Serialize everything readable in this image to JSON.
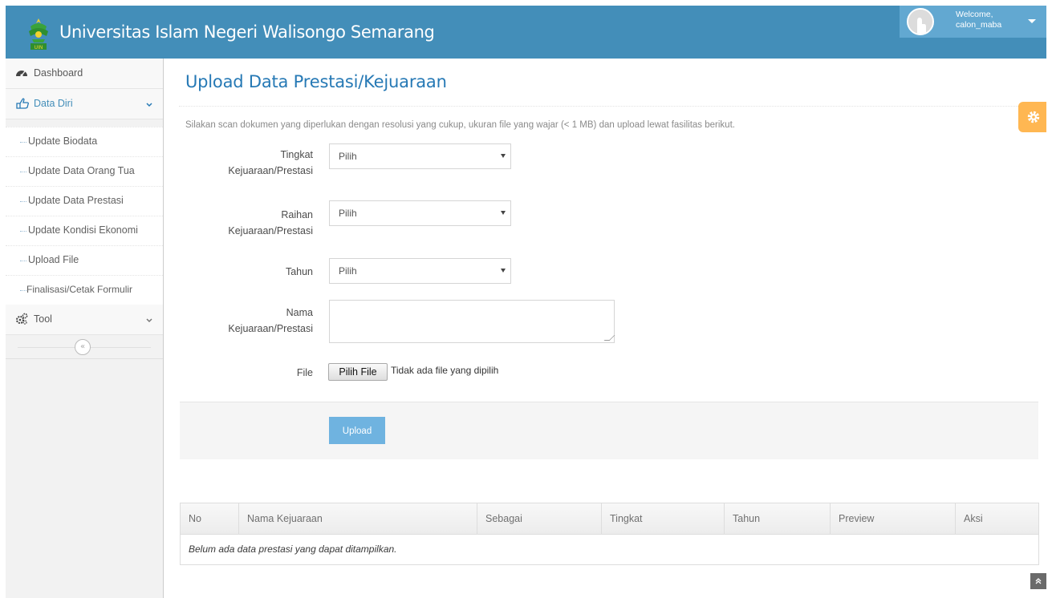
{
  "navbar": {
    "brand": "Universitas Islam Negeri Walisongo Semarang",
    "user_welcome": "Welcome,",
    "user_name": "calon_maba"
  },
  "sidebar": {
    "items": [
      {
        "label": "Dashboard",
        "icon": "tachometer-icon"
      },
      {
        "label": "Data Diri",
        "icon": "hand-pointing-icon",
        "open": true
      },
      {
        "label": "Tool",
        "icon": "gears-icon"
      }
    ],
    "submenu": [
      "Update Biodata",
      "Update Data Orang Tua",
      "Update Data Prestasi",
      "Update Kondisi Ekonomi",
      "Upload File",
      "Finalisasi/Cetak Formulir"
    ],
    "collapse_glyph": "«"
  },
  "page": {
    "title": "Upload Data Prestasi/Kejuaraan",
    "help": "Silakan scan dokumen yang diperlukan dengan resolusi yang cukup, ukuran file yang wajar (< 1 MB) dan upload lewat fasilitas berikut."
  },
  "form": {
    "tingkat_label_1": "Tingkat",
    "tingkat_label_2": "Kejuaraan/Prestasi",
    "tingkat_value": "Pilih",
    "raihan_label_1": "Raihan",
    "raihan_label_2": "Kejuaraan/Prestasi",
    "raihan_value": "Pilih",
    "tahun_label": "Tahun",
    "tahun_value": "Pilih",
    "nama_label_1": "Nama",
    "nama_label_2": "Kejuaraan/Prestasi",
    "nama_value": "",
    "file_label": "File",
    "file_button": "Pilih File",
    "file_status": "Tidak ada file yang dipilih",
    "upload_button": "Upload"
  },
  "table": {
    "headers": [
      "No",
      "Nama Kejuaraan",
      "Sebagai",
      "Tingkat",
      "Tahun",
      "Preview",
      "Aksi"
    ],
    "empty_message": "Belum ada data prestasi yang dapat ditampilkan."
  },
  "colors": {
    "navbar": "#438eb9",
    "accent": "#2679b5",
    "button": "#6fb3e0",
    "settings": "#ffb752"
  }
}
